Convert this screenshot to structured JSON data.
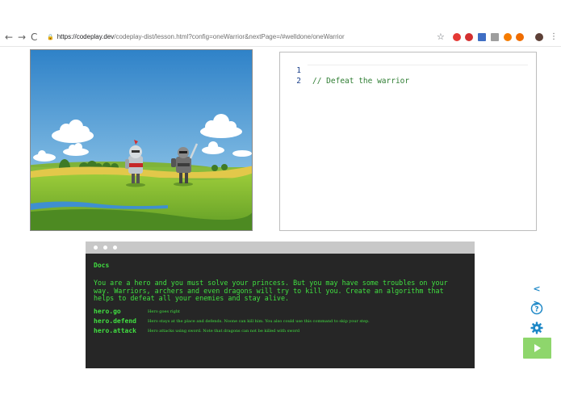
{
  "browser": {
    "back_glyph": "←",
    "forward_glyph": "→",
    "reload_glyph": "C",
    "url_host": "https://codeplay.dev",
    "url_path": "/codeplay-dist/lesson.html?config=oneWarrior&nextPage=/#welldone/oneWarrior",
    "lock_icon": "lock-icon",
    "star_icon": "star-icon",
    "extension_colors": [
      "#e53935",
      "#e53935",
      "#3f6ec4",
      "#8a8a8a",
      "#f57c00",
      "#ef6c00",
      "#5d4037"
    ]
  },
  "editor": {
    "lines": [
      {
        "number": "1",
        "code": "// Defeat the warrior"
      },
      {
        "number": "2",
        "code": ""
      }
    ]
  },
  "docs": {
    "title": "Docs",
    "intro": "You are a hero and you must solve your princess. But you may have some troubles on your way. Warriors, archers and even dragons will try to kill you. Create an algorithm that helps to defeat all your enemies and stay alive.",
    "commands": [
      {
        "name": "hero.go",
        "description": "Hero goes right"
      },
      {
        "name": "hero.defend",
        "description": "Hero stays at the place and defends. Noone can kill him. You also could use this command to skip your step."
      },
      {
        "name": "hero.attack",
        "description": "Hero attacks using sword. Note that dragons can not be killed with sword"
      }
    ]
  },
  "tools": {
    "code_icon": "code-brackets-icon",
    "code_glyph": "< >",
    "help_icon": "help-circle-icon",
    "help_glyph": "?",
    "settings_icon": "gear-icon",
    "run_icon": "play-icon"
  },
  "colors": {
    "docs_text": "#40e040",
    "docs_bg": "#262626",
    "accent_blue": "#1e88c7",
    "run_green": "#8ed66c"
  }
}
